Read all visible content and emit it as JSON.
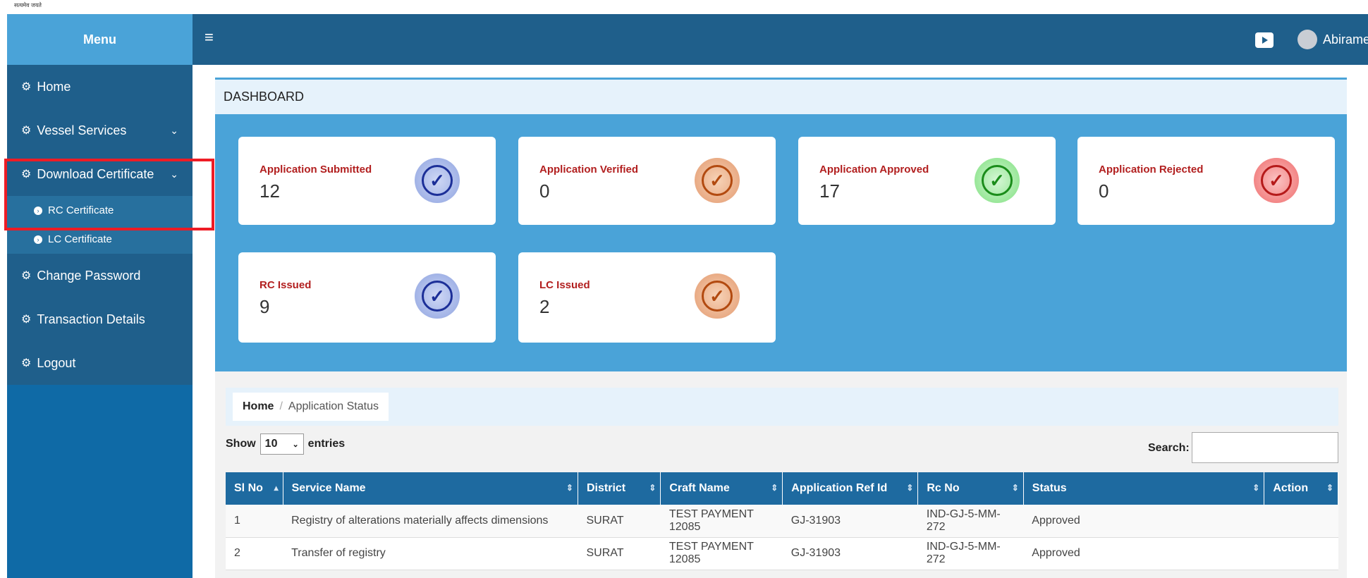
{
  "topstrip": {
    "tag": "सत्यमेव जयते"
  },
  "header": {
    "menu_label": "Menu",
    "user_name": "Abirame"
  },
  "sidebar": {
    "items": [
      {
        "label": "Home"
      },
      {
        "label": "Vessel Services"
      },
      {
        "label": "Download Certificate"
      },
      {
        "label": "RC Certificate"
      },
      {
        "label": "LC Certificate"
      },
      {
        "label": "Change Password"
      },
      {
        "label": "Transaction Details"
      },
      {
        "label": "Logout"
      }
    ]
  },
  "dashboard": {
    "title": "DASHBOARD",
    "cards": [
      {
        "label": "Application Submitted",
        "value": "12"
      },
      {
        "label": "Application Verified",
        "value": "0"
      },
      {
        "label": "Application Approved",
        "value": "17"
      },
      {
        "label": "Application Rejected",
        "value": "0"
      },
      {
        "label": "RC Issued",
        "value": "9"
      },
      {
        "label": "LC Issued",
        "value": "2"
      }
    ]
  },
  "breadcrumb": {
    "home": "Home",
    "current": "Application Status"
  },
  "table_controls": {
    "show": "Show",
    "entries_value": "10",
    "entries": "entries",
    "search_label": "Search:"
  },
  "table": {
    "headers": [
      "Sl No",
      "Service Name",
      "District",
      "Craft Name",
      "Application Ref Id",
      "Rc No",
      "Status",
      "Action"
    ],
    "rows": [
      [
        "1",
        "Registry of alterations materially affects dimensions",
        "SURAT",
        "TEST PAYMENT 12085",
        "GJ-31903",
        "IND-GJ-5-MM-272",
        "Approved",
        ""
      ],
      [
        "2",
        "Transfer of registry",
        "SURAT",
        "TEST PAYMENT 12085",
        "GJ-31903",
        "IND-GJ-5-MM-272",
        "Approved",
        ""
      ]
    ]
  },
  "colors": {
    "sidebar": "#1f5f8b",
    "accent": "#4aa3d8",
    "table_header": "#1e6aa0",
    "highlight": "#ee1c25"
  }
}
